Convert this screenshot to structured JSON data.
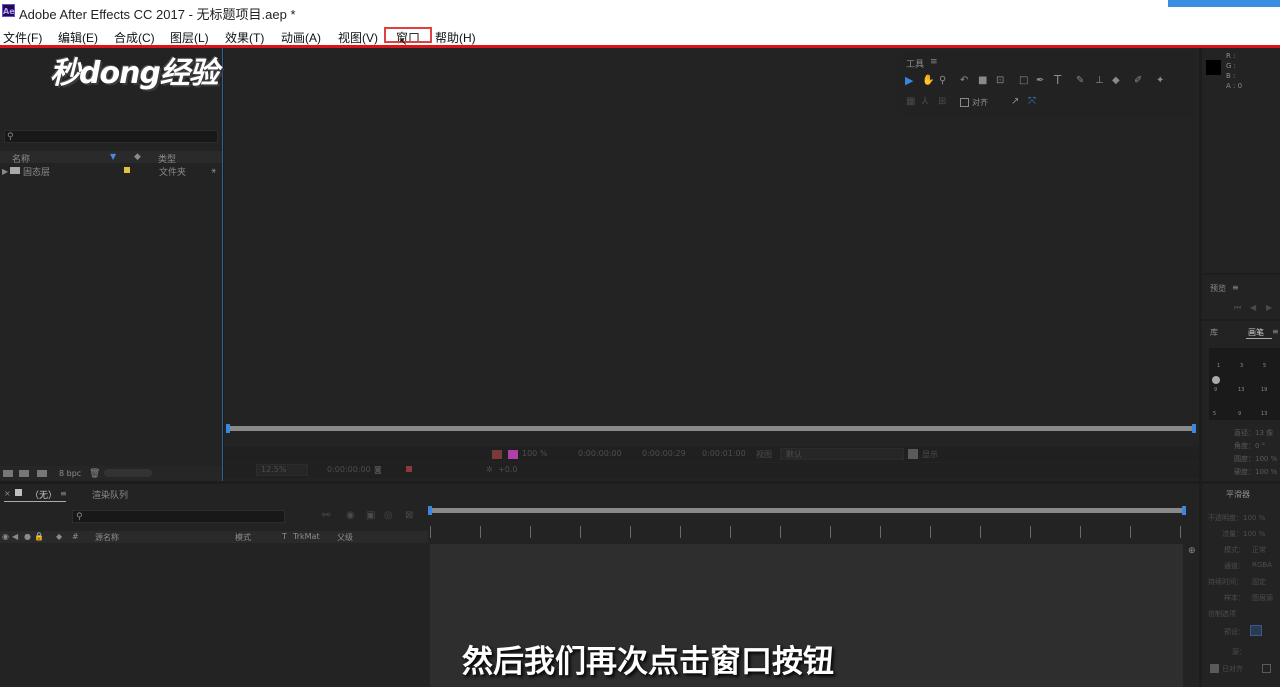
{
  "window": {
    "app_badge": "Ae",
    "title": "Adobe After Effects CC 2017 - 无标题项目.aep *"
  },
  "menu": {
    "items": [
      {
        "label": "文件(F)"
      },
      {
        "label": "编辑(E)"
      },
      {
        "label": "合成(C)"
      },
      {
        "label": "图层(L)"
      },
      {
        "label": "效果(T)"
      },
      {
        "label": "动画(A)"
      },
      {
        "label": "视图(V)"
      },
      {
        "label": "窗口"
      },
      {
        "label": "帮助(H)"
      }
    ]
  },
  "watermark": "秒dong经验",
  "project": {
    "columns": {
      "name": "名称",
      "type": "类型"
    },
    "items": [
      {
        "name": "固态层",
        "type": "文件夹"
      }
    ],
    "bpc": "8 bpc"
  },
  "tools": {
    "title": "工具",
    "align_label": "对齐"
  },
  "viewer": {
    "zoom": "100 %",
    "time1": "0:00:00:00",
    "time2": "0:00:00:29",
    "time3": "0:00:01:00",
    "view_label": "视图",
    "view_value": "默认",
    "show_label": "显示",
    "zoom2": "12.5%",
    "time_bottom": "0:00:00:00",
    "exposure": "+0.0"
  },
  "info": {
    "r": "R :",
    "g": "G :",
    "b": "B :",
    "a": "A : 0"
  },
  "preview": {
    "title": "预览"
  },
  "brushes": {
    "tab_lib": "库",
    "tab_brush": "画笔",
    "sizes": [
      "1",
      "3",
      "5",
      "9",
      "13",
      "19",
      "5",
      "9",
      "13",
      "17",
      "21",
      "27",
      "35"
    ],
    "props": [
      "直径：13 像",
      "角度：0 °",
      "圆度：100 %",
      "硬度：100 %"
    ]
  },
  "timeline": {
    "comp_tab": "（无）",
    "render_tab": "渲染队列",
    "cols": {
      "hash": "#",
      "source": "源名称",
      "mode": "模式",
      "t": "T",
      "trkmat": "TrkMat",
      "parent": "父级"
    }
  },
  "smoother": {
    "title": "平滑器",
    "rows": [
      "不透明度：100 %",
      "流量：100 %",
      "模式：",
      "通道：",
      "持续时间：",
      "样本：",
      "仿制选项",
      "预设：",
      "源："
    ],
    "values": [
      "正常",
      "RGBA",
      "固定",
      "图层源"
    ],
    "checkbox": "已对齐"
  },
  "caption": "然后我们再次点击窗口按钮"
}
